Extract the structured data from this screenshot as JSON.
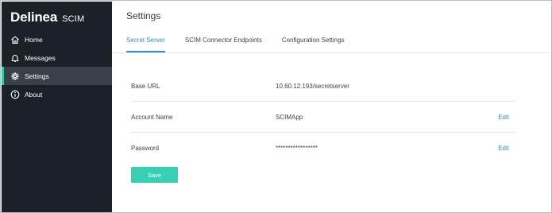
{
  "brand": {
    "logo": "Delinea",
    "product": "SCIM"
  },
  "sidebar": {
    "items": [
      {
        "label": "Home",
        "icon": "home-icon"
      },
      {
        "label": "Messages",
        "icon": "bell-icon"
      },
      {
        "label": "Settings",
        "icon": "gear-icon",
        "active": true
      },
      {
        "label": "About",
        "icon": "info-icon"
      }
    ]
  },
  "page": {
    "title": "Settings"
  },
  "tabs": [
    {
      "label": "Secret Server",
      "active": true
    },
    {
      "label": "SCIM Connector Endpoints"
    },
    {
      "label": "Configuration Settings"
    }
  ],
  "settings": {
    "base_url": {
      "label": "Base URL",
      "value": "10.60.12.193/secretserver"
    },
    "account_name": {
      "label": "Account Name",
      "value": "SCIMApp",
      "edit_label": "Edit"
    },
    "password": {
      "label": "Password",
      "value": "*****************",
      "edit_label": "Edit"
    }
  },
  "actions": {
    "save_label": "Save"
  },
  "colors": {
    "sidebar_bg": "#1b2129",
    "accent_teal": "#37d0b4",
    "link_blue": "#2a8fd6"
  }
}
